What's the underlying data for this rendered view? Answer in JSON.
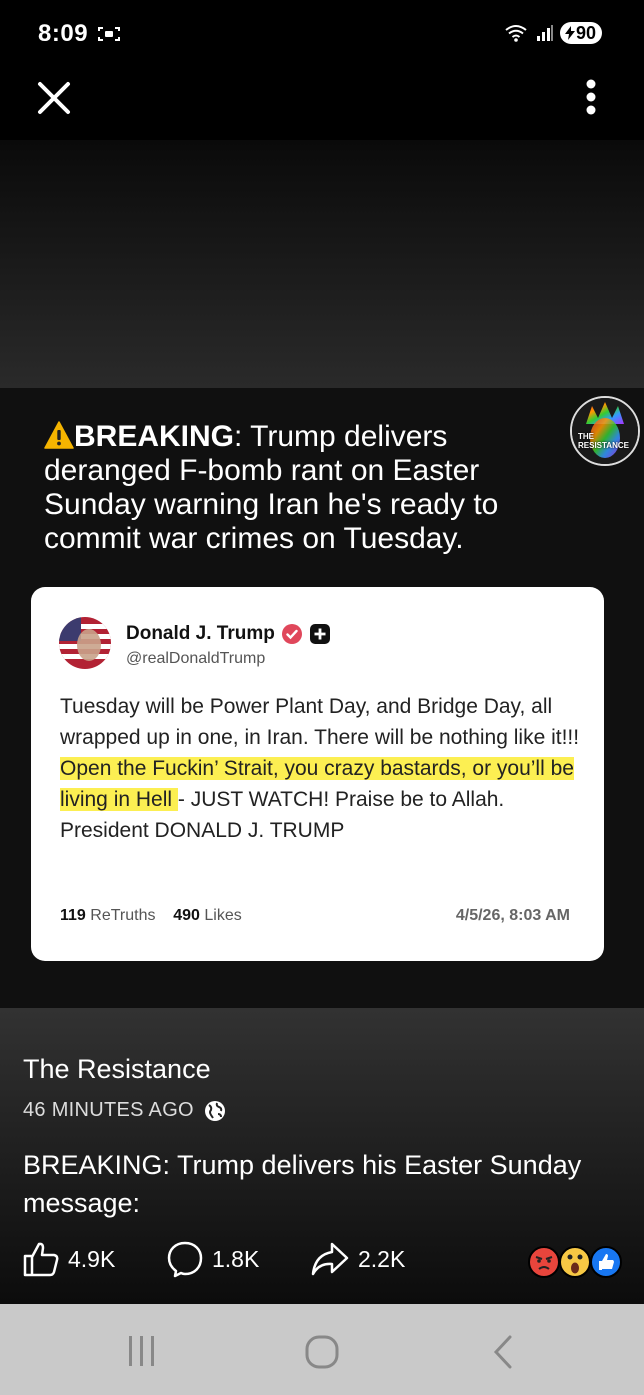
{
  "status_bar": {
    "time": "8:09",
    "battery": "90"
  },
  "post_image": {
    "headline_bold": "BREAKING",
    "headline_rest": ": Trump delivers deranged F-bomb rant on Easter Sunday warning Iran he's ready to commit war crimes on Tuesday.",
    "badge_text_line1": "THE",
    "badge_text_line2": "RESISTANCE",
    "tweet": {
      "name": "Donald J. Trump",
      "handle": "@realDonaldTrump",
      "body_before": "Tuesday will be Power Plant Day, and Bridge Day, all wrapped up in one, in Iran. There will be nothing like it!!!",
      "body_highlight": " Open the Fuckin’ Strait, you crazy bastards, or you’ll be living in Hell ",
      "body_after": "- JUST WATCH! Praise be to Allah. President DONALD J. TRUMP",
      "retruths_count": "119",
      "retruths_label": "ReTruths",
      "likes_count": "490",
      "likes_label": "Likes",
      "date": "4/5/26, 8:03 AM"
    }
  },
  "post_info": {
    "page_name": "The Resistance",
    "time_ago": "46 MINUTES AGO",
    "caption": "BREAKING: Trump delivers his Easter Sunday message:"
  },
  "actions": {
    "likes": "4.9K",
    "comments": "1.8K",
    "shares": "2.2K"
  },
  "colors": {
    "highlight": "#fcef52",
    "verified_badge": "#e0475b",
    "like_reaction": "#1877f2",
    "angry_reaction": "#e8453c",
    "wow_reaction": "#f7c844"
  }
}
